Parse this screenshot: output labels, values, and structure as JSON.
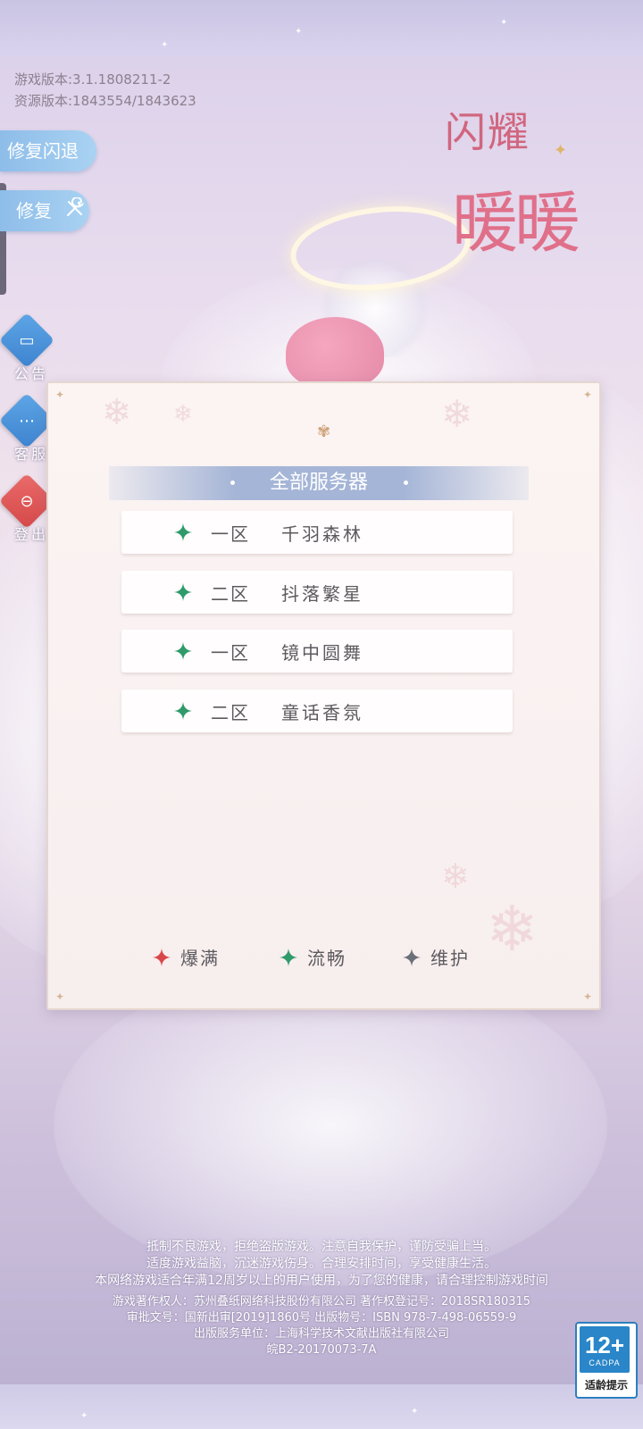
{
  "version_info": {
    "game_version": "游戏版本:3.1.1808211-2",
    "resource_version": "资源版本:1843554/1843623"
  },
  "logo": {
    "line1": "闪耀",
    "line2": "暖暖"
  },
  "left_buttons": {
    "fix_crash": "修复闪退",
    "fix": "修复"
  },
  "side_menu": {
    "announcement": "公告",
    "customer_service": "客服",
    "logout": "登出"
  },
  "server_panel": {
    "title": "全部服务器",
    "servers": [
      {
        "zone": "一区",
        "name": "千羽森林",
        "status": "流畅"
      },
      {
        "zone": "二区",
        "name": "抖落繁星",
        "status": "流畅"
      },
      {
        "zone": "一区",
        "name": "镜中圆舞",
        "status": "流畅"
      },
      {
        "zone": "二区",
        "name": "童话香氛",
        "status": "流畅"
      }
    ],
    "legend": [
      {
        "label": "爆满",
        "color": "#d9464a"
      },
      {
        "label": "流畅",
        "color": "#2f9a6a"
      },
      {
        "label": "维护",
        "color": "#6b6f78"
      }
    ]
  },
  "footer": {
    "line1": "抵制不良游戏，拒绝盗版游戏。注意自我保护，谨防受骗上当。",
    "line2": "适度游戏益脑，沉迷游戏伤身。合理安排时间，享受健康生活。",
    "line3": "本网络游戏适合年满12周岁以上的用户使用，为了您的健康，请合理控制游戏时间",
    "line4": "游戏著作权人：苏州叠纸网络科技股份有限公司 著作权登记号：2018SR180315",
    "line5": "审批文号：国新出审[2019]1860号 出版物号：ISBN 978-7-498-06559-9",
    "line6": "出版服务单位：上海科学技术文献出版社有限公司",
    "line7": "皖B2-20170073-7A"
  },
  "age_rating": {
    "age": "12+",
    "org": "CADPA",
    "tip": "适龄提示"
  },
  "colors": {
    "smooth": "#2f9a6a",
    "full": "#d9464a",
    "maintenance": "#6b6f78",
    "button_blue": "#9ac7ee"
  }
}
